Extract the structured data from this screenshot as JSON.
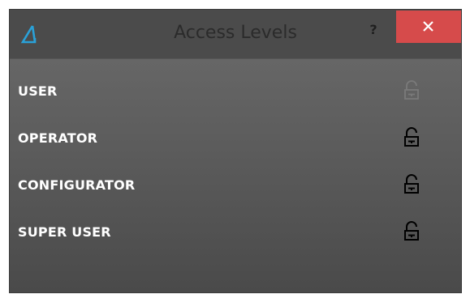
{
  "dialog": {
    "title": "Access Levels",
    "help_label": "?",
    "close_icon": "close-icon",
    "logo_icon": "triangle-logo-icon"
  },
  "colors": {
    "titlebar_bg": "#4b4b4b",
    "close_bg": "#d64b4b",
    "logo_accent": "#2aa1d8",
    "content_top": "#666666",
    "content_bottom": "#4a4a4a",
    "label_text": "#ffffff",
    "lock_active": "#000000",
    "lock_dim": "#7a7a7a"
  },
  "access_levels": [
    {
      "label": "USER",
      "lock_icon": "unlocked-padlock-icon",
      "state": "dimmed"
    },
    {
      "label": "OPERATOR",
      "lock_icon": "unlocked-padlock-icon",
      "state": "active"
    },
    {
      "label": "CONFIGURATOR",
      "lock_icon": "unlocked-padlock-icon",
      "state": "active"
    },
    {
      "label": "SUPER USER",
      "lock_icon": "unlocked-padlock-icon",
      "state": "active"
    }
  ]
}
